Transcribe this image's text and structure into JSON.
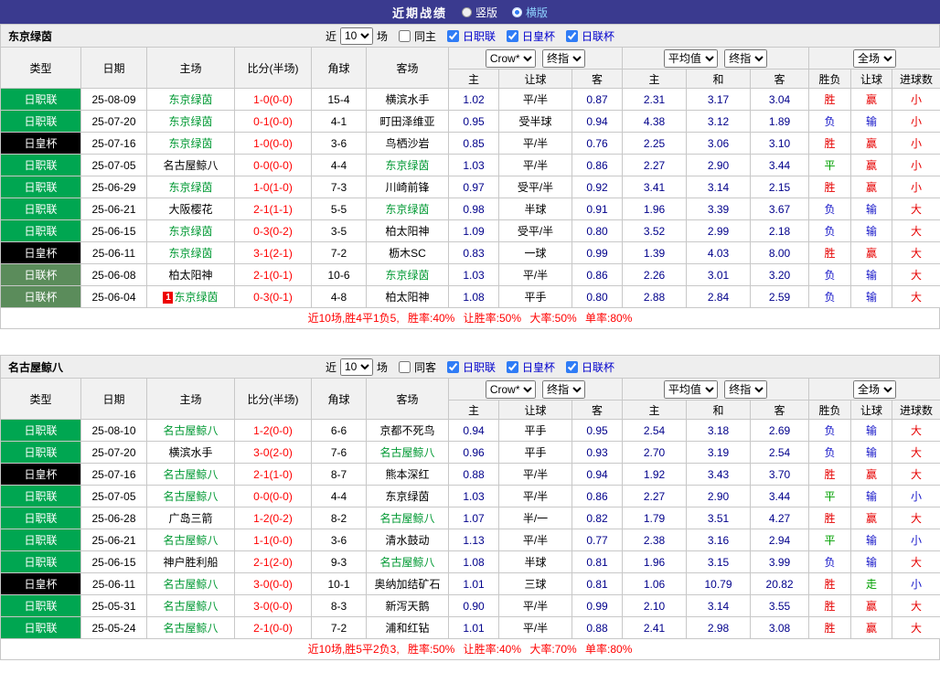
{
  "topbar": {
    "title": "近期战绩",
    "options": [
      {
        "label": "竖版",
        "selected": false
      },
      {
        "label": "横版",
        "selected": true
      }
    ]
  },
  "colors": {
    "topbar_bg": "#3a3a8f",
    "league_j1": "#00a651",
    "league_emperor": "#000000",
    "league_league_cup": "#5b8c5b",
    "result_red": "#e60000",
    "result_blue": "#1616c8",
    "result_green": "#00a000",
    "score_red": "#ff0000",
    "team_focus_green": "#009933",
    "odds_navy": "#00008b",
    "summary_red": "#ff0000"
  },
  "sections": [
    {
      "team": "东京绿茵",
      "filters": {
        "near": "近",
        "count": "10",
        "games": "场",
        "same": {
          "label": "同主",
          "checked": false
        },
        "leagues": [
          {
            "label": "日职联",
            "checked": true
          },
          {
            "label": "日皇杯",
            "checked": true
          },
          {
            "label": "日联杯",
            "checked": true
          }
        ]
      },
      "columns": {
        "type": "类型",
        "date": "日期",
        "home": "主场",
        "score": "比分(半场)",
        "corner": "角球",
        "away": "客场",
        "group1": {
          "select1": "Crow*",
          "select2": "终指",
          "subs": [
            "主",
            "让球",
            "客"
          ]
        },
        "group2": {
          "select1": "平均值",
          "select2": "终指",
          "subs": [
            "主",
            "和",
            "客"
          ]
        },
        "group3": {
          "select1": "全场",
          "subs": [
            "胜负",
            "让球",
            "进球数"
          ]
        }
      },
      "rows": [
        {
          "league": "日职联",
          "date": "25-08-09",
          "home": "东京绿茵",
          "hf": true,
          "score": "1-0(0-0)",
          "corner": "15-4",
          "away": "横滨水手",
          "af": false,
          "odds": [
            "1.02",
            "平/半",
            "0.87"
          ],
          "avg": [
            "2.31",
            "3.17",
            "3.04"
          ],
          "res": [
            [
              "胜",
              "r"
            ],
            [
              "赢",
              "r"
            ],
            [
              "小",
              "r"
            ]
          ]
        },
        {
          "league": "日职联",
          "date": "25-07-20",
          "home": "东京绿茵",
          "hf": true,
          "score": "0-1(0-0)",
          "corner": "4-1",
          "away": "町田泽维亚",
          "af": false,
          "odds": [
            "0.95",
            "受半球",
            "0.94"
          ],
          "avg": [
            "4.38",
            "3.12",
            "1.89"
          ],
          "res": [
            [
              "负",
              "b"
            ],
            [
              "输",
              "b"
            ],
            [
              "小",
              "r"
            ]
          ]
        },
        {
          "league": "日皇杯",
          "date": "25-07-16",
          "home": "东京绿茵",
          "hf": true,
          "score": "1-0(0-0)",
          "corner": "3-6",
          "away": "鸟栖沙岩",
          "af": false,
          "odds": [
            "0.85",
            "平/半",
            "0.76"
          ],
          "avg": [
            "2.25",
            "3.06",
            "3.10"
          ],
          "res": [
            [
              "胜",
              "r"
            ],
            [
              "赢",
              "r"
            ],
            [
              "小",
              "r"
            ]
          ]
        },
        {
          "league": "日职联",
          "date": "25-07-05",
          "home": "名古屋鲸八",
          "hf": false,
          "score": "0-0(0-0)",
          "corner": "4-4",
          "away": "东京绿茵",
          "af": true,
          "odds": [
            "1.03",
            "平/半",
            "0.86"
          ],
          "avg": [
            "2.27",
            "2.90",
            "3.44"
          ],
          "res": [
            [
              "平",
              "g"
            ],
            [
              "赢",
              "r"
            ],
            [
              "小",
              "r"
            ]
          ]
        },
        {
          "league": "日职联",
          "date": "25-06-29",
          "home": "东京绿茵",
          "hf": true,
          "score": "1-0(1-0)",
          "corner": "7-3",
          "away": "川崎前锋",
          "af": false,
          "odds": [
            "0.97",
            "受平/半",
            "0.92"
          ],
          "avg": [
            "3.41",
            "3.14",
            "2.15"
          ],
          "res": [
            [
              "胜",
              "r"
            ],
            [
              "赢",
              "r"
            ],
            [
              "小",
              "r"
            ]
          ]
        },
        {
          "league": "日职联",
          "date": "25-06-21",
          "home": "大阪樱花",
          "hf": false,
          "score": "2-1(1-1)",
          "corner": "5-5",
          "away": "东京绿茵",
          "af": true,
          "odds": [
            "0.98",
            "半球",
            "0.91"
          ],
          "avg": [
            "1.96",
            "3.39",
            "3.67"
          ],
          "res": [
            [
              "负",
              "b"
            ],
            [
              "输",
              "b"
            ],
            [
              "大",
              "r"
            ]
          ]
        },
        {
          "league": "日职联",
          "date": "25-06-15",
          "home": "东京绿茵",
          "hf": true,
          "score": "0-3(0-2)",
          "corner": "3-5",
          "away": "柏太阳神",
          "af": false,
          "odds": [
            "1.09",
            "受平/半",
            "0.80"
          ],
          "avg": [
            "3.52",
            "2.99",
            "2.18"
          ],
          "res": [
            [
              "负",
              "b"
            ],
            [
              "输",
              "b"
            ],
            [
              "大",
              "r"
            ]
          ]
        },
        {
          "league": "日皇杯",
          "date": "25-06-11",
          "home": "东京绿茵",
          "hf": true,
          "score": "3-1(2-1)",
          "corner": "7-2",
          "away": "枥木SC",
          "af": false,
          "odds": [
            "0.83",
            "一球",
            "0.99"
          ],
          "avg": [
            "1.39",
            "4.03",
            "8.00"
          ],
          "res": [
            [
              "胜",
              "r"
            ],
            [
              "赢",
              "r"
            ],
            [
              "大",
              "r"
            ]
          ]
        },
        {
          "league": "日联杯",
          "date": "25-06-08",
          "home": "柏太阳神",
          "hf": false,
          "score": "2-1(0-1)",
          "corner": "10-6",
          "away": "东京绿茵",
          "af": true,
          "odds": [
            "1.03",
            "平/半",
            "0.86"
          ],
          "avg": [
            "2.26",
            "3.01",
            "3.20"
          ],
          "res": [
            [
              "负",
              "b"
            ],
            [
              "输",
              "b"
            ],
            [
              "大",
              "r"
            ]
          ]
        },
        {
          "league": "日联杯",
          "date": "25-06-04",
          "home": "东京绿茵",
          "hf": true,
          "badge": "1",
          "score": "0-3(0-1)",
          "corner": "4-8",
          "away": "柏太阳神",
          "af": false,
          "odds": [
            "1.08",
            "平手",
            "0.80"
          ],
          "avg": [
            "2.88",
            "2.84",
            "2.59"
          ],
          "res": [
            [
              "负",
              "b"
            ],
            [
              "输",
              "b"
            ],
            [
              "大",
              "r"
            ]
          ]
        }
      ],
      "summary": "近10场,胜4平1负5, 胜率:40% 让胜率:50% 大率:50% 单率:80%"
    },
    {
      "team": "名古屋鲸八",
      "filters": {
        "near": "近",
        "count": "10",
        "games": "场",
        "same": {
          "label": "同客",
          "checked": false
        },
        "leagues": [
          {
            "label": "日职联",
            "checked": true
          },
          {
            "label": "日皇杯",
            "checked": true
          },
          {
            "label": "日联杯",
            "checked": true
          }
        ]
      },
      "columns": {
        "type": "类型",
        "date": "日期",
        "home": "主场",
        "score": "比分(半场)",
        "corner": "角球",
        "away": "客场",
        "group1": {
          "select1": "Crow*",
          "select2": "终指",
          "subs": [
            "主",
            "让球",
            "客"
          ]
        },
        "group2": {
          "select1": "平均值",
          "select2": "终指",
          "subs": [
            "主",
            "和",
            "客"
          ]
        },
        "group3": {
          "select1": "全场",
          "subs": [
            "胜负",
            "让球",
            "进球数"
          ]
        }
      },
      "rows": [
        {
          "league": "日职联",
          "date": "25-08-10",
          "home": "名古屋鲸八",
          "hf": true,
          "score": "1-2(0-0)",
          "corner": "6-6",
          "away": "京都不死鸟",
          "af": false,
          "odds": [
            "0.94",
            "平手",
            "0.95"
          ],
          "avg": [
            "2.54",
            "3.18",
            "2.69"
          ],
          "res": [
            [
              "负",
              "b"
            ],
            [
              "输",
              "b"
            ],
            [
              "大",
              "r"
            ]
          ]
        },
        {
          "league": "日职联",
          "date": "25-07-20",
          "home": "横滨水手",
          "hf": false,
          "score": "3-0(2-0)",
          "corner": "7-6",
          "away": "名古屋鲸八",
          "af": true,
          "odds": [
            "0.96",
            "平手",
            "0.93"
          ],
          "avg": [
            "2.70",
            "3.19",
            "2.54"
          ],
          "res": [
            [
              "负",
              "b"
            ],
            [
              "输",
              "b"
            ],
            [
              "大",
              "r"
            ]
          ]
        },
        {
          "league": "日皇杯",
          "date": "25-07-16",
          "home": "名古屋鲸八",
          "hf": true,
          "score": "2-1(1-0)",
          "corner": "8-7",
          "away": "熊本深红",
          "af": false,
          "odds": [
            "0.88",
            "平/半",
            "0.94"
          ],
          "avg": [
            "1.92",
            "3.43",
            "3.70"
          ],
          "res": [
            [
              "胜",
              "r"
            ],
            [
              "赢",
              "r"
            ],
            [
              "大",
              "r"
            ]
          ]
        },
        {
          "league": "日职联",
          "date": "25-07-05",
          "home": "名古屋鲸八",
          "hf": true,
          "score": "0-0(0-0)",
          "corner": "4-4",
          "away": "东京绿茵",
          "af": false,
          "odds": [
            "1.03",
            "平/半",
            "0.86"
          ],
          "avg": [
            "2.27",
            "2.90",
            "3.44"
          ],
          "res": [
            [
              "平",
              "g"
            ],
            [
              "输",
              "b"
            ],
            [
              "小",
              "b"
            ]
          ]
        },
        {
          "league": "日职联",
          "date": "25-06-28",
          "home": "广岛三箭",
          "hf": false,
          "score": "1-2(0-2)",
          "corner": "8-2",
          "away": "名古屋鲸八",
          "af": true,
          "odds": [
            "1.07",
            "半/一",
            "0.82"
          ],
          "avg": [
            "1.79",
            "3.51",
            "4.27"
          ],
          "res": [
            [
              "胜",
              "r"
            ],
            [
              "赢",
              "r"
            ],
            [
              "大",
              "r"
            ]
          ]
        },
        {
          "league": "日职联",
          "date": "25-06-21",
          "home": "名古屋鲸八",
          "hf": true,
          "score": "1-1(0-0)",
          "corner": "3-6",
          "away": "清水鼓动",
          "af": false,
          "odds": [
            "1.13",
            "平/半",
            "0.77"
          ],
          "avg": [
            "2.38",
            "3.16",
            "2.94"
          ],
          "res": [
            [
              "平",
              "g"
            ],
            [
              "输",
              "b"
            ],
            [
              "小",
              "b"
            ]
          ]
        },
        {
          "league": "日职联",
          "date": "25-06-15",
          "home": "神户胜利船",
          "hf": false,
          "score": "2-1(2-0)",
          "corner": "9-3",
          "away": "名古屋鲸八",
          "af": true,
          "odds": [
            "1.08",
            "半球",
            "0.81"
          ],
          "avg": [
            "1.96",
            "3.15",
            "3.99"
          ],
          "res": [
            [
              "负",
              "b"
            ],
            [
              "输",
              "b"
            ],
            [
              "大",
              "r"
            ]
          ]
        },
        {
          "league": "日皇杯",
          "date": "25-06-11",
          "home": "名古屋鲸八",
          "hf": true,
          "score": "3-0(0-0)",
          "corner": "10-1",
          "away": "奥纳加结矿石",
          "af": false,
          "odds": [
            "1.01",
            "三球",
            "0.81"
          ],
          "avg": [
            "1.06",
            "10.79",
            "20.82"
          ],
          "res": [
            [
              "胜",
              "r"
            ],
            [
              "走",
              "g"
            ],
            [
              "小",
              "b"
            ]
          ]
        },
        {
          "league": "日职联",
          "date": "25-05-31",
          "home": "名古屋鲸八",
          "hf": true,
          "score": "3-0(0-0)",
          "corner": "8-3",
          "away": "新泻天鹅",
          "af": false,
          "odds": [
            "0.90",
            "平/半",
            "0.99"
          ],
          "avg": [
            "2.10",
            "3.14",
            "3.55"
          ],
          "res": [
            [
              "胜",
              "r"
            ],
            [
              "赢",
              "r"
            ],
            [
              "大",
              "r"
            ]
          ]
        },
        {
          "league": "日职联",
          "date": "25-05-24",
          "home": "名古屋鲸八",
          "hf": true,
          "score": "2-1(0-0)",
          "corner": "7-2",
          "away": "浦和红钻",
          "af": false,
          "odds": [
            "1.01",
            "平/半",
            "0.88"
          ],
          "avg": [
            "2.41",
            "2.98",
            "3.08"
          ],
          "res": [
            [
              "胜",
              "r"
            ],
            [
              "赢",
              "r"
            ],
            [
              "大",
              "r"
            ]
          ]
        }
      ],
      "summary": "近10场,胜5平2负3, 胜率:50% 让胜率:40% 大率:70% 单率:80%"
    }
  ]
}
